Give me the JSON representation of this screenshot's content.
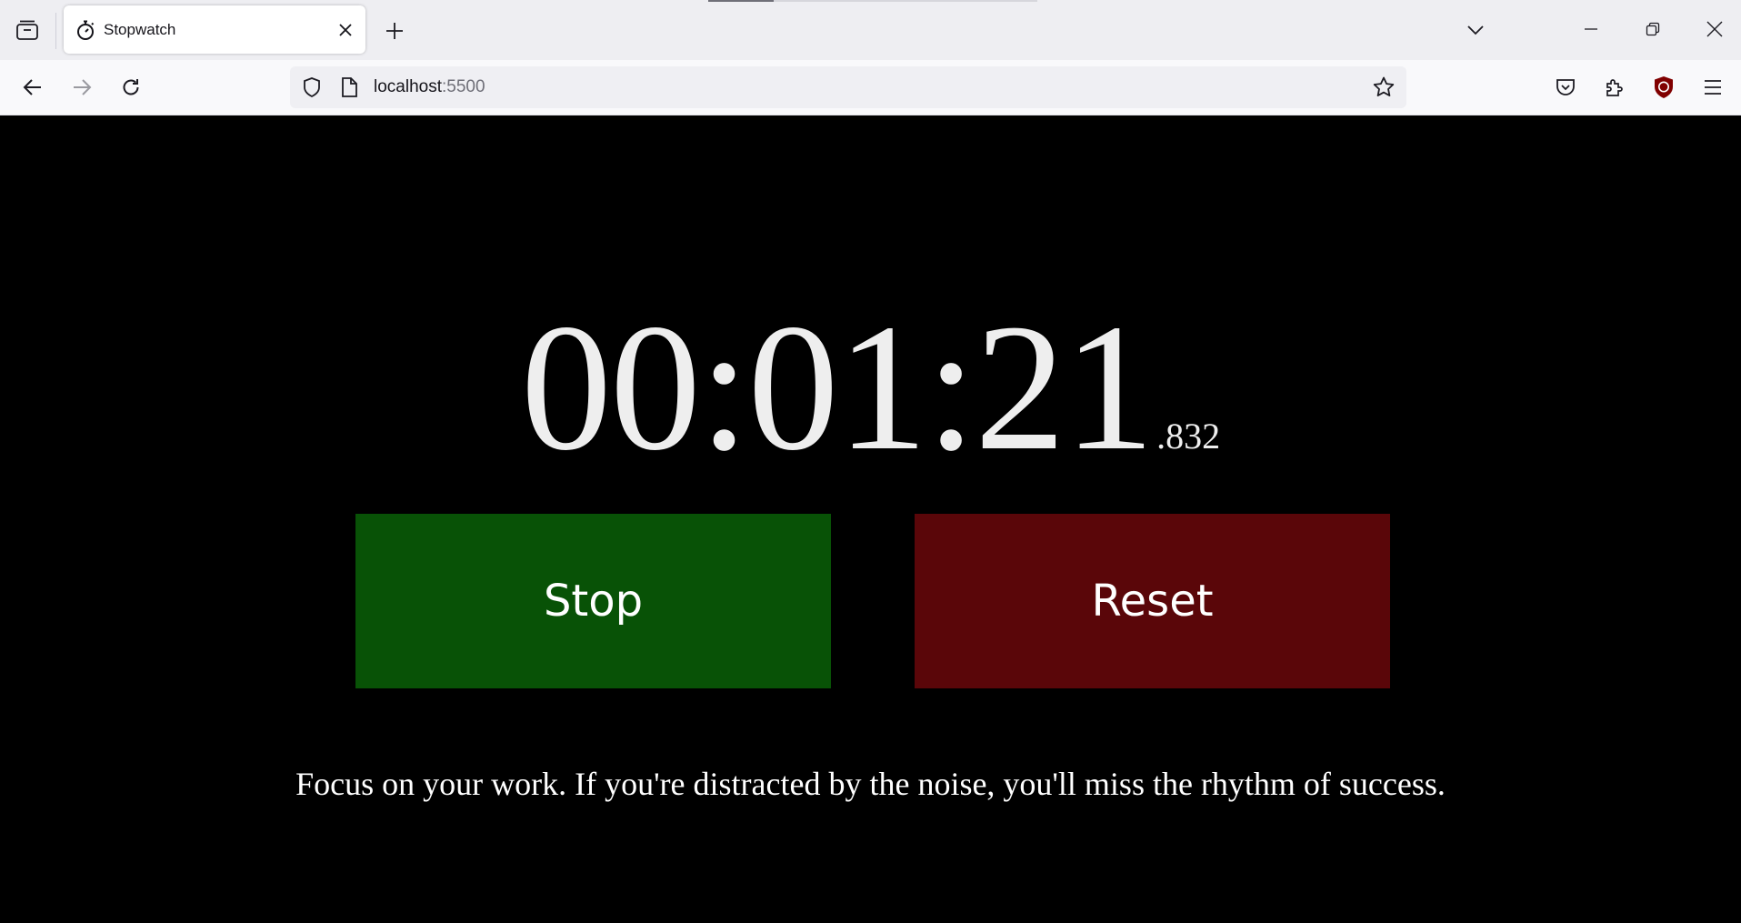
{
  "browser": {
    "tab": {
      "title": "Stopwatch"
    },
    "url": {
      "host": "localhost",
      "port": ":5500"
    }
  },
  "stopwatch": {
    "time_main": "00:01:21",
    "time_ms": ".832",
    "stop_label": "Stop",
    "reset_label": "Reset",
    "quote": "Focus on your work. If you're distracted by the noise, you'll miss the rhythm of success."
  },
  "colors": {
    "stop_button": "#085206",
    "reset_button": "#5a0609",
    "page_background": "#000000",
    "time_text": "#eeeeee"
  },
  "icons": [
    "tab-list-icon",
    "stopwatch-icon",
    "close-icon",
    "plus-icon",
    "chevron-down-icon",
    "minimize-icon",
    "restore-icon",
    "window-close-icon",
    "back-arrow-icon",
    "forward-arrow-icon",
    "reload-icon",
    "shield-icon",
    "page-icon",
    "star-icon",
    "pocket-icon",
    "puzzle-icon",
    "ublock-icon",
    "hamburger-menu-icon"
  ]
}
